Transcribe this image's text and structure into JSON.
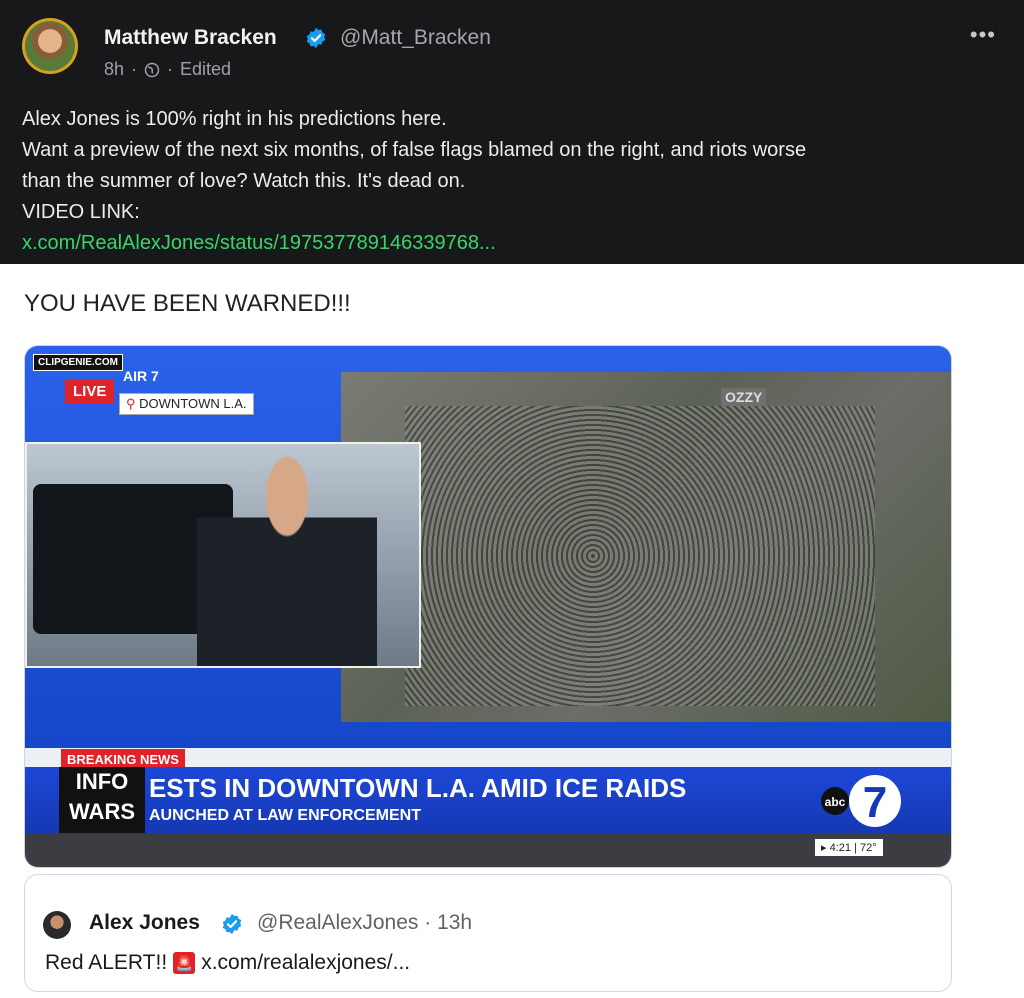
{
  "post": {
    "author_name": "Matthew Bracken",
    "author_handle": "@Matt_Bracken",
    "time": "8h",
    "dot1": "·",
    "dot2": "·",
    "edited": "Edited",
    "more": "•••",
    "text_lines": [
      "Alex Jones is 100% right in his predictions here.",
      "Want a preview of the next six months, of false flags blamed on the right, and riots worse",
      "than the summer of love? Watch this. It's dead on.",
      "VIDEO LINK:"
    ],
    "link": "x.com/RealAlexJones/status/197537789146339768..."
  },
  "card": {
    "heading": "YOU HAVE BEEN WARNED!!!",
    "video": {
      "clip_label": "CLIPGENIE.COM",
      "live": "LIVE",
      "air": "AIR 7",
      "location": "DOWNTOWN L.A.",
      "building_sign": "OZZY",
      "breaking": "BREAKING NEWS",
      "logo_line1": "INFO",
      "logo_line2": "WARS",
      "headline": "ESTS IN DOWNTOWN L.A. AMID ICE RAIDS",
      "subheadline": "AUNCHED AT LAW ENFORCEMENT",
      "network": "abc",
      "channel": "7",
      "ticker": "▸ 4:21 | 72°"
    }
  },
  "quoted": {
    "name": "Alex Jones",
    "handle": "@RealAlexJones · 13h",
    "text": "Red ALERT!!",
    "link": "x.com/realalexjones/..."
  },
  "colors": {
    "link": "#3bd36a",
    "verified": "#1d9bf0",
    "breaking_red": "#e0232b",
    "tv_blue": "#1646c9"
  },
  "icons": [
    "verified-badge-icon",
    "globe-icon",
    "more-icon",
    "location-pin-icon",
    "siren-emoji-icon"
  ]
}
